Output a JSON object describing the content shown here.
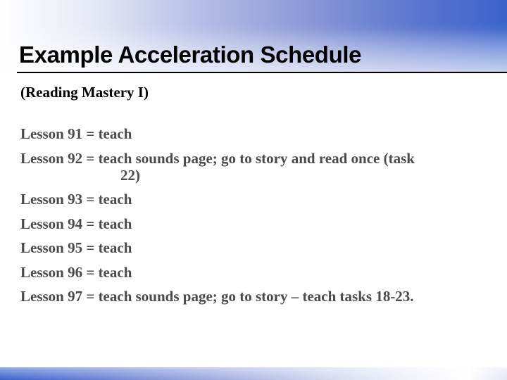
{
  "slide": {
    "title": "Example Acceleration Schedule",
    "subtitle": "(Reading Mastery I)",
    "lessons": [
      {
        "text": "Lesson 91 = teach",
        "continuation": ""
      },
      {
        "text": "Lesson 92 = teach sounds page; go to story and read once (task",
        "continuation": "22)"
      },
      {
        "text": "Lesson 93 = teach",
        "continuation": ""
      },
      {
        "text": "Lesson 94 = teach",
        "continuation": ""
      },
      {
        "text": "Lesson 95 = teach",
        "continuation": ""
      },
      {
        "text": "Lesson 96 = teach",
        "continuation": ""
      },
      {
        "text": "Lesson 97 = teach sounds page; go to story – teach tasks 18-23.",
        "continuation": ""
      }
    ]
  },
  "colors": {
    "accent_blue": "#3a63cc",
    "title_text": "#000000",
    "body_text": "#4a4a4a"
  }
}
